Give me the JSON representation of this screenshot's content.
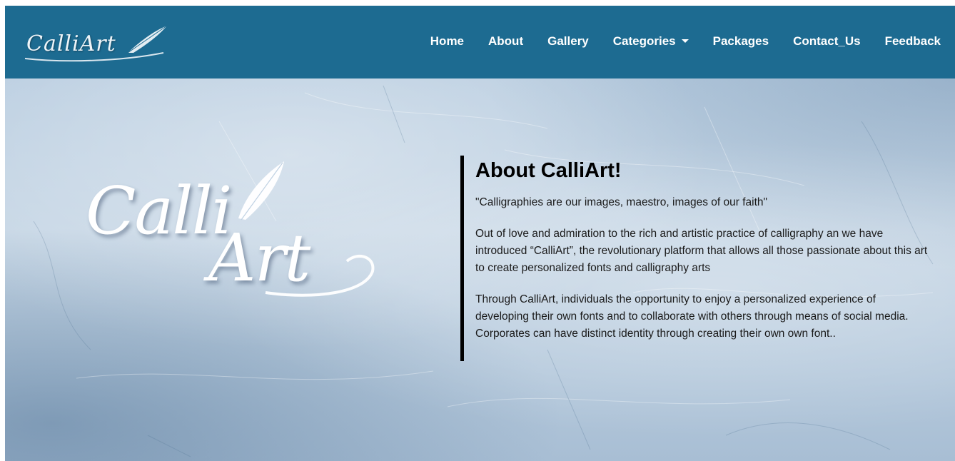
{
  "brand": {
    "logo_text": "CalliArt",
    "icon": "quill-feather-icon"
  },
  "nav": {
    "items": [
      {
        "label": "Home"
      },
      {
        "label": "About"
      },
      {
        "label": "Gallery"
      },
      {
        "label": "Categories",
        "has_dropdown": true,
        "icon": "caret-down-icon"
      },
      {
        "label": "Packages"
      },
      {
        "label": "Contact_Us"
      },
      {
        "label": "Feedback"
      }
    ]
  },
  "hero": {
    "logo_line1": "Calli",
    "logo_line2": "Art"
  },
  "about": {
    "heading": "About CalliArt!",
    "quote": "\"Calligraphies are our images, maestro, images of our faith\"",
    "paragraph1": "Out of love and admiration to the rich and artistic practice of calligraphy an we have introduced “CalliArt”, the revolutionary platform that allows all those passionate about this art to create personalized fonts and calligraphy arts",
    "paragraph2": "Through CalliArt, individuals the opportunity to enjoy a personalized experience of developing their own fonts and to collaborate with others through means of social media. Corporates can have distinct identity through creating their own own font.."
  },
  "colors": {
    "navbar": "#1d6b91",
    "nav_text": "#ffffff",
    "accent_border": "#000000",
    "hero_base": "#c0d2e3"
  }
}
